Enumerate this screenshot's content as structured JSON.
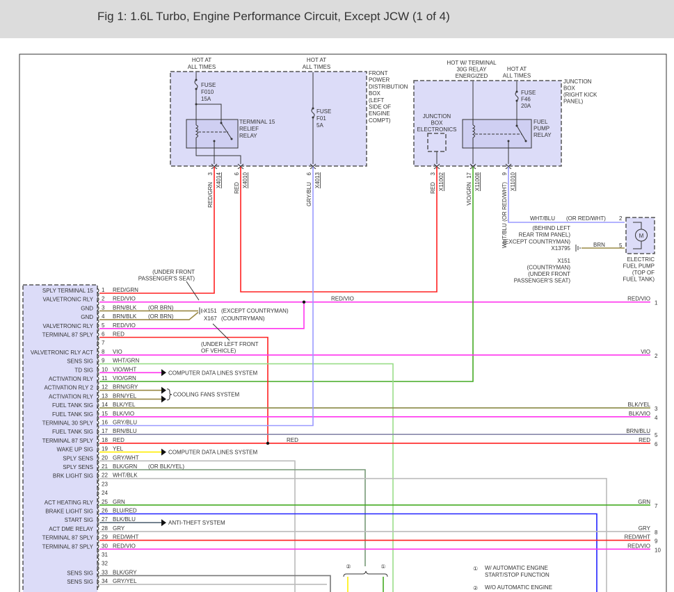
{
  "title": "Fig 1: 1.6L Turbo, Engine Performance Circuit, Except JCW (1 of 4)",
  "colors": {
    "red": "#ff2020",
    "vio": "#ff33ee",
    "green": "#44aa22",
    "blue": "#2222ff",
    "gray": "#bbbbbb",
    "brown": "#998844",
    "lav": "#9999ff",
    "yellow": "#ffee00",
    "lgreen": "#99dd88",
    "dgray": "#777777",
    "module_fill": "#dcdcf8"
  },
  "front_box": {
    "hot1": [
      "HOT AT",
      "ALL TIMES"
    ],
    "hot2": [
      "HOT AT",
      "ALL TIMES"
    ],
    "fuse1": [
      "FUSE",
      "F010",
      "15A"
    ],
    "relay": [
      "TERMINAL 15",
      "RELIEF",
      "RELAY"
    ],
    "fuse2": [
      "FUSE",
      "F01",
      "5A"
    ],
    "label": [
      "FRONT",
      "POWER",
      "DISTRIBUTION",
      "BOX",
      "(LEFT",
      "SIDE OF",
      "ENGINE",
      "COMPT)"
    ]
  },
  "junction_box": {
    "hot1": [
      "HOT W/ TERMINAL",
      "30G RELAY",
      "ENERGIZED"
    ],
    "hot2": [
      "HOT AT",
      "ALL TIMES"
    ],
    "fuse": [
      "FUSE",
      "F46",
      "20A"
    ],
    "electronics": [
      "JUNCTION",
      "BOX",
      "ELECTRONICS"
    ],
    "relay": [
      "FUEL",
      "PUMP",
      "RELAY"
    ],
    "label": [
      "JUNCTION",
      "BOX",
      "(RIGHT KICK",
      "PANEL)"
    ]
  },
  "top_connectors": [
    {
      "wire": "RED/GRN",
      "pin": "3",
      "conn": "X4014"
    },
    {
      "wire": "RED",
      "pin": "6",
      "conn": "X4010"
    },
    {
      "wire": "GRY/BLU",
      "pin": "6",
      "conn": "X4013"
    },
    {
      "wire": "RED",
      "pin": "3",
      "conn": "X11002"
    },
    {
      "wire": "VIO/GRN",
      "pin": "17",
      "conn": "X11008"
    },
    {
      "wire": "WHT/BLU (OR RED/WHT)",
      "pin": "9",
      "conn": "X11010"
    }
  ],
  "fuel_pump": {
    "wire1": "WHT/BLU",
    "wire1_alt": "(OR RED/WHT)",
    "pin1": "2",
    "wire2": "BRN",
    "pin2": "5",
    "ground_note": [
      "(BEHIND LEFT",
      "REAR TRIM PANEL)",
      "(EXCEPT COUNTRYMAN)",
      "X13795"
    ],
    "ground_note2": [
      "X151",
      "(COUNTRYMAN)",
      "(UNDER FRONT",
      "PASSENGER'S SEAT)"
    ],
    "label": [
      "ELECTRIC",
      "FUEL PUMP",
      "(TOP OF",
      "FUEL TANK)"
    ],
    "motor": "M"
  },
  "annotations": {
    "under_front": [
      "(UNDER FRONT",
      "PASSENGER'S SEAT)"
    ],
    "x151": "X151",
    "x151_note": "(EXCEPT COUNTRYMAN)",
    "x167": "X167",
    "x167_note": "(COUNTRYMAN)",
    "under_left": [
      "(UNDER LEFT FRONT",
      "OF VEHICLE)"
    ],
    "red_mid": "RED",
    "red_vio_mid": "RED/VIO",
    "cdl1": "COMPUTER DATA LINES SYSTEM",
    "cooling": "COOLING FANS SYSTEM",
    "cdl2": "COMPUTER DATA LINES SYSTEM",
    "antitheft": "ANTI-THEFT SYSTEM",
    "or_blk_yel": "(OR BLK/YEL)"
  },
  "pins": [
    {
      "n": "1",
      "label": "SPLY TERMINAL 15",
      "wire": "RED/GRN"
    },
    {
      "n": "2",
      "label": "VALVETRONIC RLY",
      "wire": "RED/VIO"
    },
    {
      "n": "3",
      "label": "GND",
      "wire": "BRN/BLK",
      "note": "(OR BRN)"
    },
    {
      "n": "4",
      "label": "GND",
      "wire": "BRN/BLK",
      "note": "(OR BRN)"
    },
    {
      "n": "5",
      "label": "VALVETRONIC RLY",
      "wire": "RED/VIO"
    },
    {
      "n": "6",
      "label": "TERMINAL 87 SPLY",
      "wire": "RED"
    },
    {
      "n": "7",
      "label": "",
      "wire": ""
    },
    {
      "n": "8",
      "label": "VALVETRONIC RLY ACT",
      "wire": "VIO"
    },
    {
      "n": "9",
      "label": "SENS SIG",
      "wire": "WHT/GRN"
    },
    {
      "n": "10",
      "label": "TD SIG",
      "wire": "VIO/WHT"
    },
    {
      "n": "11",
      "label": "ACTIVATION RLY",
      "wire": "VIO/GRN"
    },
    {
      "n": "12",
      "label": "ACTIVATION RLY 2",
      "wire": "BRN/GRY"
    },
    {
      "n": "13",
      "label": "ACTIVATION RLY",
      "wire": "BRN/YEL"
    },
    {
      "n": "14",
      "label": "FUEL TANK SIG",
      "wire": "BLK/YEL"
    },
    {
      "n": "15",
      "label": "FUEL TANK SIG",
      "wire": "BLK/VIO"
    },
    {
      "n": "16",
      "label": "TERMINAL 30 SPLY",
      "wire": "GRY/BLU"
    },
    {
      "n": "17",
      "label": "FUEL TANK SIG",
      "wire": "BRN/BLU"
    },
    {
      "n": "18",
      "label": "TERMINAL 87 SPLY",
      "wire": "RED"
    },
    {
      "n": "19",
      "label": "WAKE UP SIG",
      "wire": "YEL"
    },
    {
      "n": "20",
      "label": "SPLY SENS",
      "wire": "GRY/WHT"
    },
    {
      "n": "21",
      "label": "SPLY SENS",
      "wire": "BLK/GRN"
    },
    {
      "n": "22",
      "label": "BRK LIGHT SIG",
      "wire": "WHT/BLK"
    },
    {
      "n": "23",
      "label": "",
      "wire": ""
    },
    {
      "n": "24",
      "label": "",
      "wire": ""
    },
    {
      "n": "25",
      "label": "ACT HEATING RLY",
      "wire": "GRN"
    },
    {
      "n": "26",
      "label": "BRAKE LIGHT SIG",
      "wire": "BLU/RED"
    },
    {
      "n": "27",
      "label": "START SIG",
      "wire": "BLK/BLU"
    },
    {
      "n": "28",
      "label": "ACT DME RELAY",
      "wire": "GRY"
    },
    {
      "n": "29",
      "label": "TERMINAL 87 SPLY",
      "wire": "RED/WHT"
    },
    {
      "n": "30",
      "label": "TERMINAL 87 SPLY",
      "wire": "RED/VIO"
    },
    {
      "n": "31",
      "label": "",
      "wire": ""
    },
    {
      "n": "32",
      "label": "",
      "wire": ""
    },
    {
      "n": "33",
      "label": "SENS SIG",
      "wire": "BLK/GRY"
    },
    {
      "n": "34",
      "label": "SENS SIG",
      "wire": "GRY/YEL"
    }
  ],
  "right_labels": [
    {
      "wire": "RED/VIO",
      "n": "1"
    },
    {
      "wire": "VIO",
      "n": "2"
    },
    {
      "wire": "BLK/YEL",
      "n": "3"
    },
    {
      "wire": "BLK/VIO",
      "n": "4"
    },
    {
      "wire": "BRN/BLU",
      "n": "5"
    },
    {
      "wire": "RED",
      "n": "6"
    },
    {
      "wire": "GRN",
      "n": "7"
    },
    {
      "wire": "GRY",
      "n": "8"
    },
    {
      "wire": "RED/WHT",
      "n": "9"
    },
    {
      "wire": "RED/VIO",
      "n": "10"
    }
  ],
  "footnotes": {
    "circle2": "②",
    "circle1": "①",
    "note1_mark": "①",
    "note1": [
      "W/ AUTOMATIC ENGINE",
      "START/STOP FUNCTION"
    ],
    "note2_mark": "②",
    "note2": "W/O AUTOMATIC ENGINE"
  }
}
